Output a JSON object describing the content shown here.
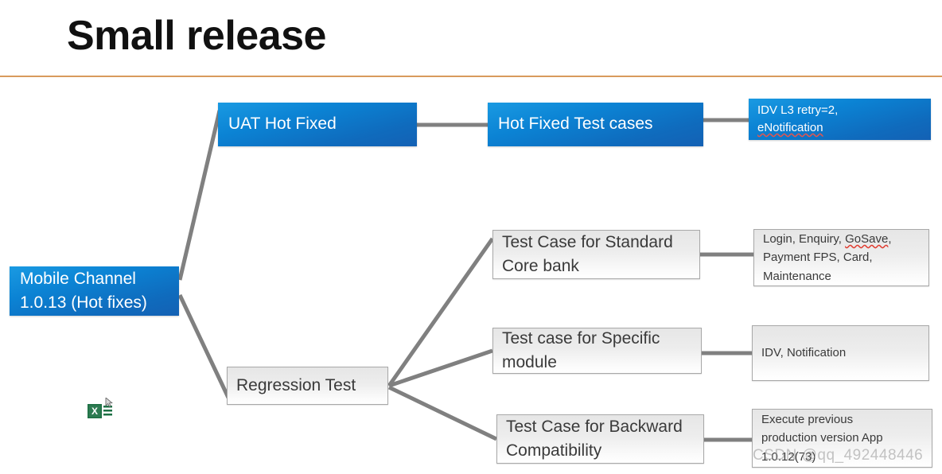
{
  "slide": {
    "title": "Small release",
    "accent_rule_color": "#d89a5c",
    "background_color": "#ffffff"
  },
  "colors": {
    "blue_node_top": "#1a9ae2",
    "blue_node_bottom": "#1461b4",
    "gray_node_top": "#e6e6e6",
    "gray_node_bottom": "#ffffff",
    "gray_node_border": "#a8a8a8",
    "connector": "#808080",
    "text_dark": "#3a3a3a",
    "text_light": "#ffffff",
    "spellcheck_underline": "#e03b2f"
  },
  "diagram": {
    "root": {
      "label": "Mobile Channel\n1.0.13 (Hot fixes)",
      "style": "blue"
    },
    "nodes": {
      "uat_hot_fixed": {
        "label": "UAT Hot Fixed",
        "style": "blue"
      },
      "hot_fixed_test_cases": {
        "label": "Hot Fixed Test cases",
        "style": "blue"
      },
      "idv_detail": {
        "line1": "IDV L3 retry=2,",
        "line2_spell": "eNotification",
        "style": "blue"
      },
      "regression_test": {
        "label": "Regression Test",
        "style": "gray"
      },
      "standard_core": {
        "label": "Test Case for Standard\nCore bank",
        "style": "gray"
      },
      "standard_core_detail": {
        "part1": "Login, Enquiry, ",
        "part2_spell": "GoSave",
        "part3": ",\nPayment FPS, Card,\nMaintenance",
        "style": "gray"
      },
      "specific_module": {
        "label": "Test case for Specific\nmodule",
        "style": "gray"
      },
      "specific_module_detail": {
        "label": "IDV, Notification",
        "style": "gray"
      },
      "backward_compat": {
        "label": "Test Case for Backward\nCompatibility",
        "style": "gray"
      },
      "backward_compat_detail": {
        "label": "Execute previous\nproduction version App\n1.0.12(73)",
        "style": "gray"
      }
    },
    "edges": [
      {
        "from": "root",
        "to": "uat_hot_fixed"
      },
      {
        "from": "root",
        "to": "regression_test"
      },
      {
        "from": "uat_hot_fixed",
        "to": "hot_fixed_test_cases"
      },
      {
        "from": "hot_fixed_test_cases",
        "to": "idv_detail"
      },
      {
        "from": "regression_test",
        "to": "standard_core"
      },
      {
        "from": "regression_test",
        "to": "specific_module"
      },
      {
        "from": "regression_test",
        "to": "backward_compat"
      },
      {
        "from": "standard_core",
        "to": "standard_core_detail"
      },
      {
        "from": "specific_module",
        "to": "specific_module_detail"
      },
      {
        "from": "backward_compat",
        "to": "backward_compat_detail"
      }
    ]
  },
  "embedded_object": {
    "icon": "excel-spreadsheet-icon",
    "cursor": "pointer-arrow-icon"
  },
  "watermark": {
    "text": "CSDN @qq_492448446"
  }
}
